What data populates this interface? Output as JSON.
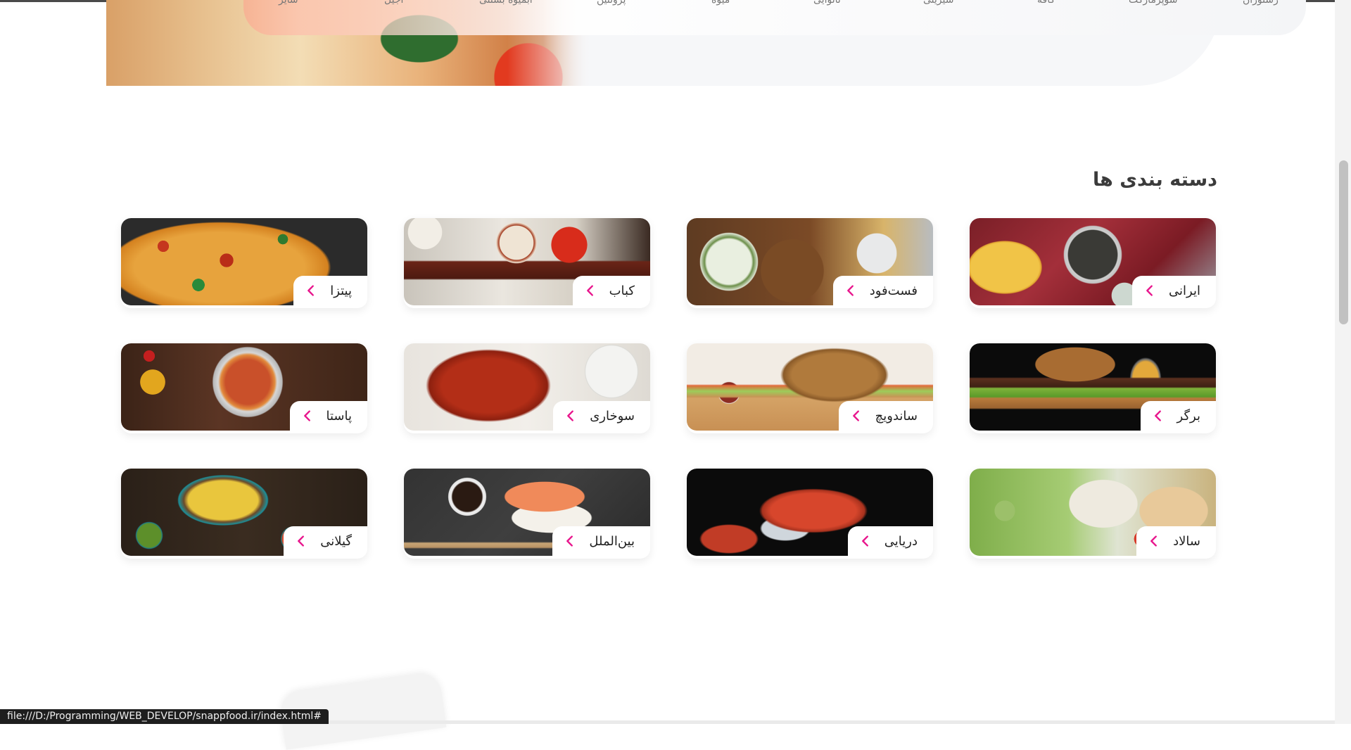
{
  "hero": {
    "strip_items": [
      "رستوران",
      "سوپرمارکت",
      "کافه",
      "شیرینی",
      "نانوایی",
      "میوه",
      "پروتئین",
      "آبمیوه بستنی",
      "آجیل",
      "سایر"
    ]
  },
  "section": {
    "title": "دسته بندی ها"
  },
  "categories": [
    {
      "label": "ایرانی",
      "image": "irani"
    },
    {
      "label": "فست‌فود",
      "image": "fast"
    },
    {
      "label": "کباب",
      "image": "kabab"
    },
    {
      "label": "پیتزا",
      "image": "pizza"
    },
    {
      "label": "برگر",
      "image": "burger"
    },
    {
      "label": "ساندویچ",
      "image": "sandwich"
    },
    {
      "label": "سوخاری",
      "image": "sokhari"
    },
    {
      "label": "پاستا",
      "image": "pasta"
    },
    {
      "label": "سالاد",
      "image": "salad"
    },
    {
      "label": "دریایی",
      "image": "daryaei"
    },
    {
      "label": "بین‌الملل",
      "image": "sushi"
    },
    {
      "label": "گیلانی",
      "image": "gilani"
    }
  ],
  "colors": {
    "chevron": "#e8158c",
    "title": "#3b3b3b"
  },
  "icons": {
    "card_arrow": "chevron-left-icon"
  },
  "status_bar": {
    "url": "file:///D:/Programming/WEB_DEVELOP/snappfood.ir/index.html#"
  }
}
